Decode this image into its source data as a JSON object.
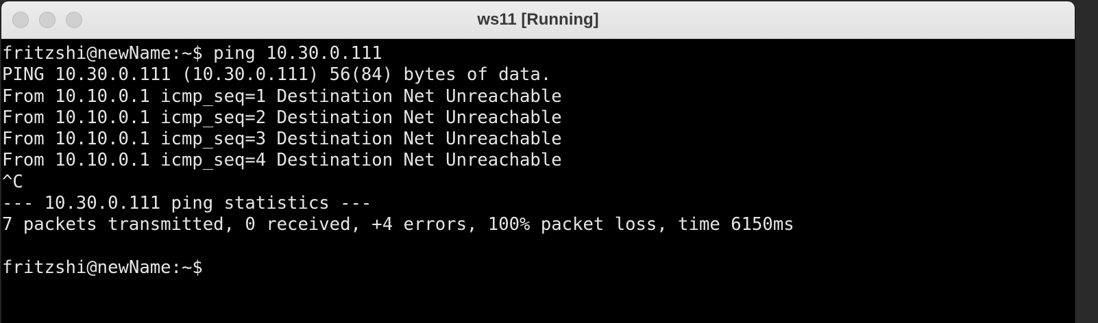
{
  "window": {
    "title": "ws11 [Running]"
  },
  "terminal": {
    "lines": [
      "fritzshi@newName:~$ ping 10.30.0.111",
      "PING 10.30.0.111 (10.30.0.111) 56(84) bytes of data.",
      "From 10.10.0.1 icmp_seq=1 Destination Net Unreachable",
      "From 10.10.0.1 icmp_seq=2 Destination Net Unreachable",
      "From 10.10.0.1 icmp_seq=3 Destination Net Unreachable",
      "From 10.10.0.1 icmp_seq=4 Destination Net Unreachable",
      "^C",
      "--- 10.30.0.111 ping statistics ---",
      "7 packets transmitted, 0 received, +4 errors, 100% packet loss, time 6150ms",
      "",
      "fritzshi@newName:~$"
    ]
  },
  "colors": {
    "terminal_bg": "#000000",
    "terminal_fg": "#e6e6e6",
    "titlebar_bg": "#e8e8e8",
    "traffic_light_inactive": "#d0d0d0"
  },
  "icons": {
    "close": "close-icon",
    "minimize": "minimize-icon",
    "zoom": "zoom-icon"
  }
}
